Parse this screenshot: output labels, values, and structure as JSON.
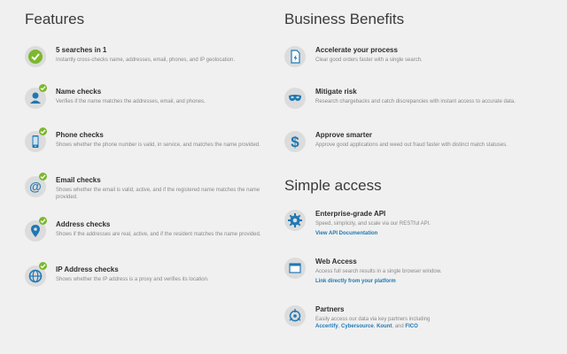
{
  "features": {
    "title": "Features",
    "items": [
      {
        "title": "5 searches in 1",
        "desc": "Instantly cross-checks name, addresses, email, phones, and IP geolocation.",
        "icon": "check-circle-icon"
      },
      {
        "title": "Name checks",
        "desc": "Verifies if the name matches the addresses, email, and phones.",
        "icon": "person-icon"
      },
      {
        "title": "Phone checks",
        "desc": "Shows whether the phone number is valid, in service, and matches the name provided.",
        "icon": "phone-icon"
      },
      {
        "title": "Email checks",
        "desc": "Shows whether the email is valid, active, and if the registered name matches the name provided.",
        "icon": "at-icon"
      },
      {
        "title": "Address checks",
        "desc": "Shows if the addresses are real, active, and if the resident matches the name provided.",
        "icon": "map-pin-icon"
      },
      {
        "title": "IP Address checks",
        "desc": "Shows whether the IP address is a proxy and verifies its location.",
        "icon": "globe-icon"
      }
    ]
  },
  "benefits": {
    "title": "Business Benefits",
    "items": [
      {
        "title": "Accelerate your process",
        "desc": "Clear good orders faster with a single search.",
        "icon": "document-icon"
      },
      {
        "title": "Mitigate risk",
        "desc": "Research chargebacks and catch discrepancies with instant access to accurate data.",
        "icon": "mask-icon"
      },
      {
        "title": "Approve smarter",
        "desc": "Approve good applications and weed out fraud faster with distinct match statuses.",
        "icon": "dollar-icon"
      }
    ]
  },
  "access": {
    "title": "Simple access",
    "items": [
      {
        "title": "Enterprise-grade API",
        "desc": "Speed, simplicity, and scale via our RESTful API.",
        "link": "View API Documentation",
        "icon": "gear-icon"
      },
      {
        "title": "Web Access",
        "desc": "Access full search results in a single browser window.",
        "link": "Link directly from your platform",
        "icon": "browser-icon"
      },
      {
        "title": "Partners",
        "desc": "Easily access our data via key partners including",
        "partners": [
          "Accertify",
          "Cybersource",
          "Kount"
        ],
        "partners_sep": ", ",
        "partners_and": ", and ",
        "partners_last": "FICO",
        "icon": "partners-icon"
      }
    ]
  },
  "colors": {
    "background": "#f0f0f0",
    "icon_bg": "#dcdcdc",
    "check": "#7cb82f",
    "icon_blue": "#1f78b4",
    "link": "#1f78b4"
  }
}
